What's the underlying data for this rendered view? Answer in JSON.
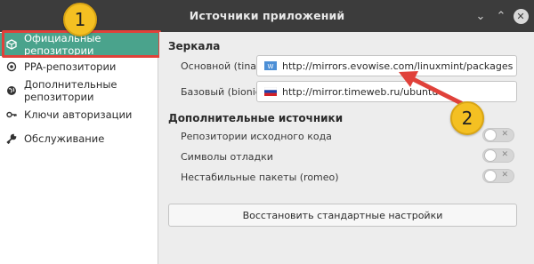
{
  "window": {
    "title": "Источники приложений",
    "controls": {
      "minimize": "⌄",
      "maximize": "⌃",
      "close": "✕"
    }
  },
  "sidebar": {
    "items": [
      {
        "label": "Официальные репозитории",
        "icon": "box-icon",
        "active": true
      },
      {
        "label": "PPA-репозитории",
        "icon": "ppa-icon",
        "active": false
      },
      {
        "label": "Дополнительные репозитории",
        "icon": "globe-icon",
        "active": false
      },
      {
        "label": "Ключи авторизации",
        "icon": "key-icon",
        "active": false
      },
      {
        "label": "Обслуживание",
        "icon": "wrench-icon",
        "active": false
      }
    ]
  },
  "mirrors": {
    "title": "Зеркала",
    "primary": {
      "label": "Основной (tina)",
      "url": "http://mirrors.evowise.com/linuxmint/packages",
      "flag": "flag-generic-icon"
    },
    "base": {
      "label": "Базовый (bionic)",
      "url": "http://mirror.timeweb.ru/ubuntu",
      "flag": "flag-russia-icon"
    }
  },
  "extra_sources": {
    "title": "Дополнительные источники",
    "options": [
      {
        "label": "Репозитории исходного кода",
        "enabled": false
      },
      {
        "label": "Символы отладки",
        "enabled": false
      },
      {
        "label": "Нестабильные пакеты (romeo)",
        "enabled": false
      }
    ],
    "toggle_off_glyph": "✕"
  },
  "reset_button": {
    "label": "Восстановить стандартные настройки"
  },
  "annotations": {
    "callout_1": "1",
    "callout_2": "2",
    "accent_color": "#e0413a",
    "callout_color": "#f4c022"
  },
  "colors": {
    "titlebar": "#3c3c3c",
    "active_item": "#4aa38c"
  }
}
